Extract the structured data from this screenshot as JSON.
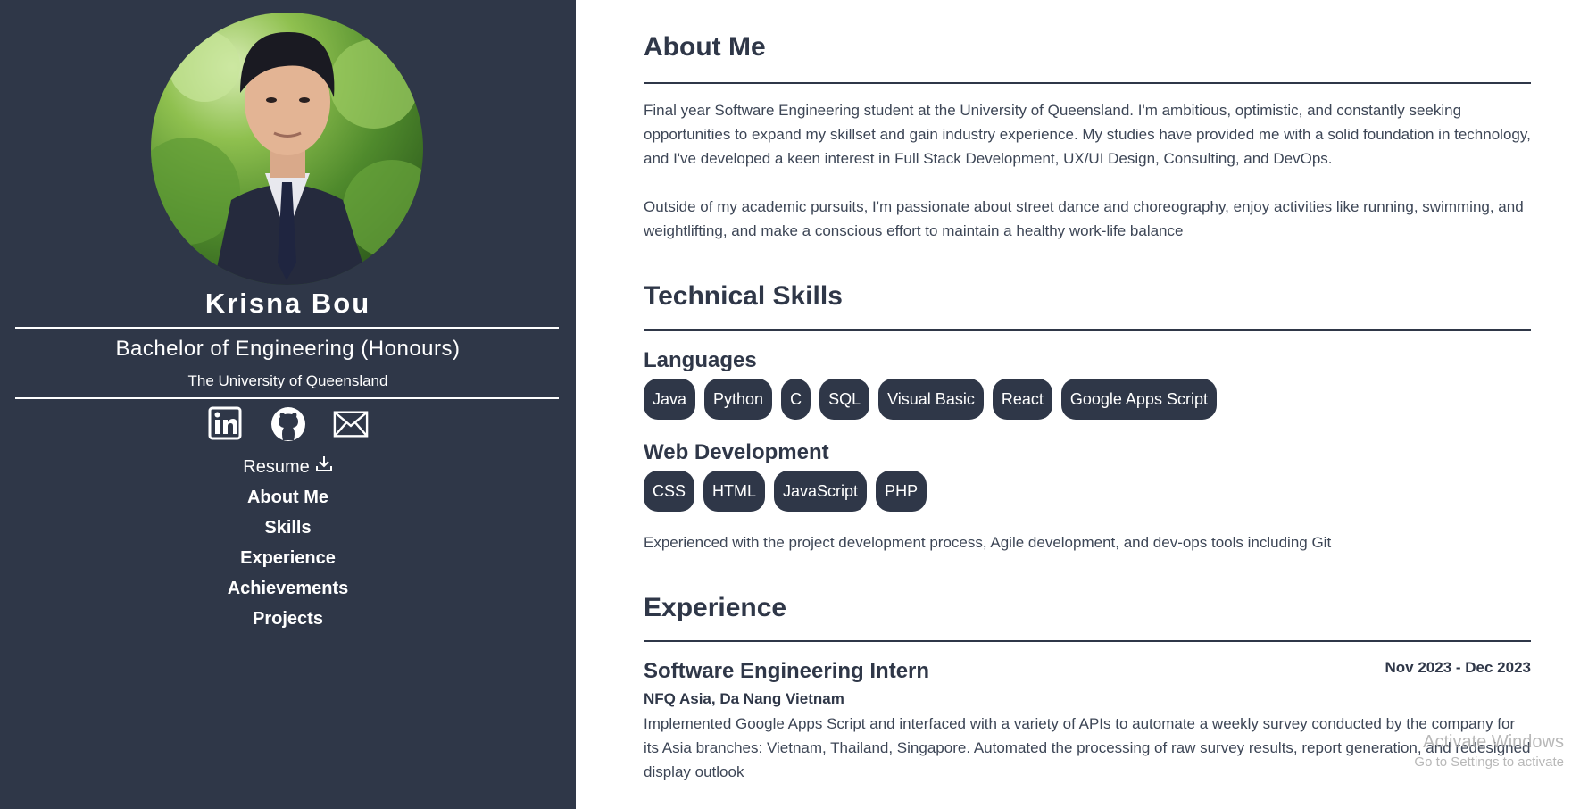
{
  "sidebar": {
    "name": "Krisna Bou",
    "degree": "Bachelor of Engineering (Honours)",
    "university": "The University of Queensland",
    "social": [
      {
        "icon": "linkedin-icon"
      },
      {
        "icon": "github-icon"
      },
      {
        "icon": "mail-icon"
      }
    ],
    "resume_label": "Resume",
    "nav": [
      "About Me",
      "Skills",
      "Experience",
      "Achievements",
      "Projects"
    ]
  },
  "about": {
    "title": "About Me",
    "paragraphs": [
      "Final year Software Engineering student at the University of Queensland. I'm ambitious, optimistic, and constantly seeking opportunities to expand my skillset and gain industry experience. My studies have provided me with a solid foundation in technology, and I've developed a keen interest in Full Stack Development, UX/UI Design, Consulting, and DevOps.",
      "Outside of my academic pursuits, I'm passionate about street dance and choreography, enjoy activities like running, swimming, and weightlifting, and make a conscious effort to maintain a healthy work-life balance"
    ]
  },
  "skills": {
    "title": "Technical Skills",
    "languages_title": "Languages",
    "languages": [
      "Java",
      "Python",
      "C",
      "SQL",
      "Visual Basic",
      "React",
      "Google Apps Script"
    ],
    "web_title": "Web Development",
    "web": [
      "CSS",
      "HTML",
      "JavaScript",
      "PHP"
    ],
    "note": "Experienced with the project development process, Agile development, and dev-ops tools including Git"
  },
  "experience": {
    "title": "Experience",
    "jobs": [
      {
        "title": "Software Engineering Intern",
        "date": "Nov 2023 - Dec 2023",
        "company": "NFQ Asia, Da Nang Vietnam",
        "description": "Implemented Google Apps Script and interfaced with a variety of APIs to automate a weekly survey conducted by the company for its Asia branches: Vietnam, Thailand, Singapore. Automated the processing of raw survey results, report generation, and redesigned display outlook"
      }
    ]
  },
  "watermark": {
    "line1": "Activate Windows",
    "line2": "Go to Settings to activate"
  },
  "colors": {
    "sidebar_bg": "#2f3748",
    "pill_bg": "#2f3748",
    "text": "#3d4656"
  }
}
